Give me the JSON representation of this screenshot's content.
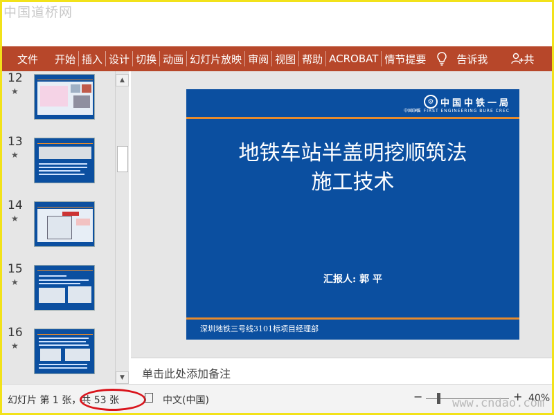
{
  "watermarks": {
    "top": "中国道桥网",
    "bottom": "www.cndao.com"
  },
  "ribbon": {
    "file": "文件",
    "tabs": [
      "开始",
      "插入",
      "设计",
      "切换",
      "动画",
      "幻灯片放映",
      "审阅",
      "视图",
      "帮助",
      "ACROBAT",
      "情节提要"
    ],
    "tell_me": "告诉我",
    "share_partial": "共"
  },
  "thumbnails": [
    {
      "number": "12",
      "style": "white"
    },
    {
      "number": "13",
      "style": "white"
    },
    {
      "number": "14",
      "style": "white"
    },
    {
      "number": "15",
      "style": "white"
    },
    {
      "number": "16",
      "style": "blue"
    }
  ],
  "slide": {
    "logo_cn": "中国中铁一局",
    "logo_small": "中国中铁",
    "logo_en": "THE FIRST ENGINEERING BURE CREC",
    "title_line1": "地铁车站半盖明挖顺筑法",
    "title_line2": "施工技术",
    "reporter": "汇报人: 郭 平",
    "footer": "深圳地铁三号线3101标项目经理部",
    "colors": {
      "background": "#0b4fa0",
      "accent": "#e88b2c"
    }
  },
  "notes": {
    "placeholder": "单击此处添加备注"
  },
  "status": {
    "slide_count": "幻灯片 第 1 张，共 53 张",
    "language": "中文(中国)",
    "zoom_minus": "−",
    "zoom_plus": "+",
    "zoom": "40%"
  },
  "colors": {
    "ribbon": "#b7472a",
    "highlight_circle": "#d9141c"
  }
}
